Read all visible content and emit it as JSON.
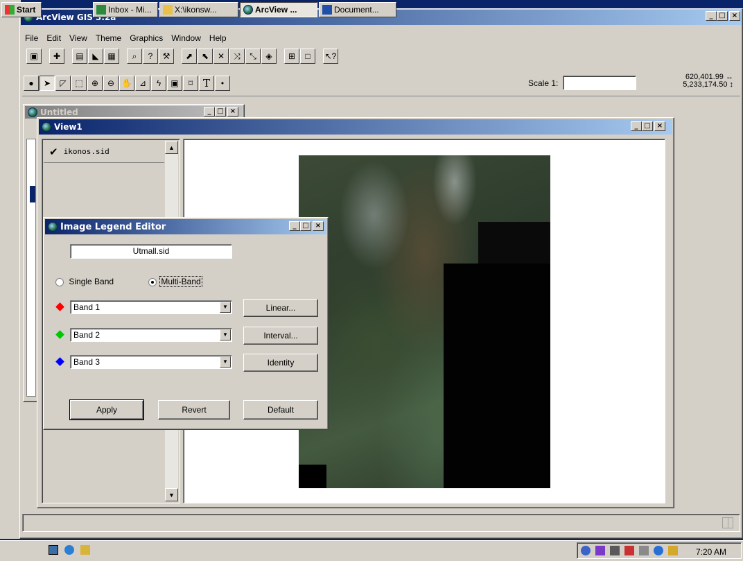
{
  "app": {
    "title": "ArcView GIS 3.2a"
  },
  "menu": [
    "File",
    "Edit",
    "View",
    "Theme",
    "Graphics",
    "Window",
    "Help"
  ],
  "scale": {
    "label": "Scale 1:",
    "value": ""
  },
  "coords": {
    "x": "620,401.99",
    "y": "5,233,174.50"
  },
  "untitled": {
    "title": "Untitled"
  },
  "view": {
    "title": "View1",
    "theme_name": "ikonos.sid"
  },
  "dialog": {
    "title": "Image Legend Editor",
    "file": "Utmall.sid",
    "single_band_label": "Single Band",
    "multi_band_label": "Multi-Band",
    "bands": [
      {
        "color": "#ff0000",
        "value": "Band 1",
        "button": "Linear..."
      },
      {
        "color": "#00c800",
        "value": "Band 2",
        "button": "Interval..."
      },
      {
        "color": "#0000ff",
        "value": "Band 3",
        "button": "Identity"
      }
    ],
    "apply": "Apply",
    "revert": "Revert",
    "default": "Default"
  },
  "taskbar": {
    "start": "Start",
    "tasks": [
      "Inbox - Mi...",
      "X:\\ikonsw...",
      "ArcView ...",
      "Document..."
    ],
    "clock": "7:20 AM"
  }
}
